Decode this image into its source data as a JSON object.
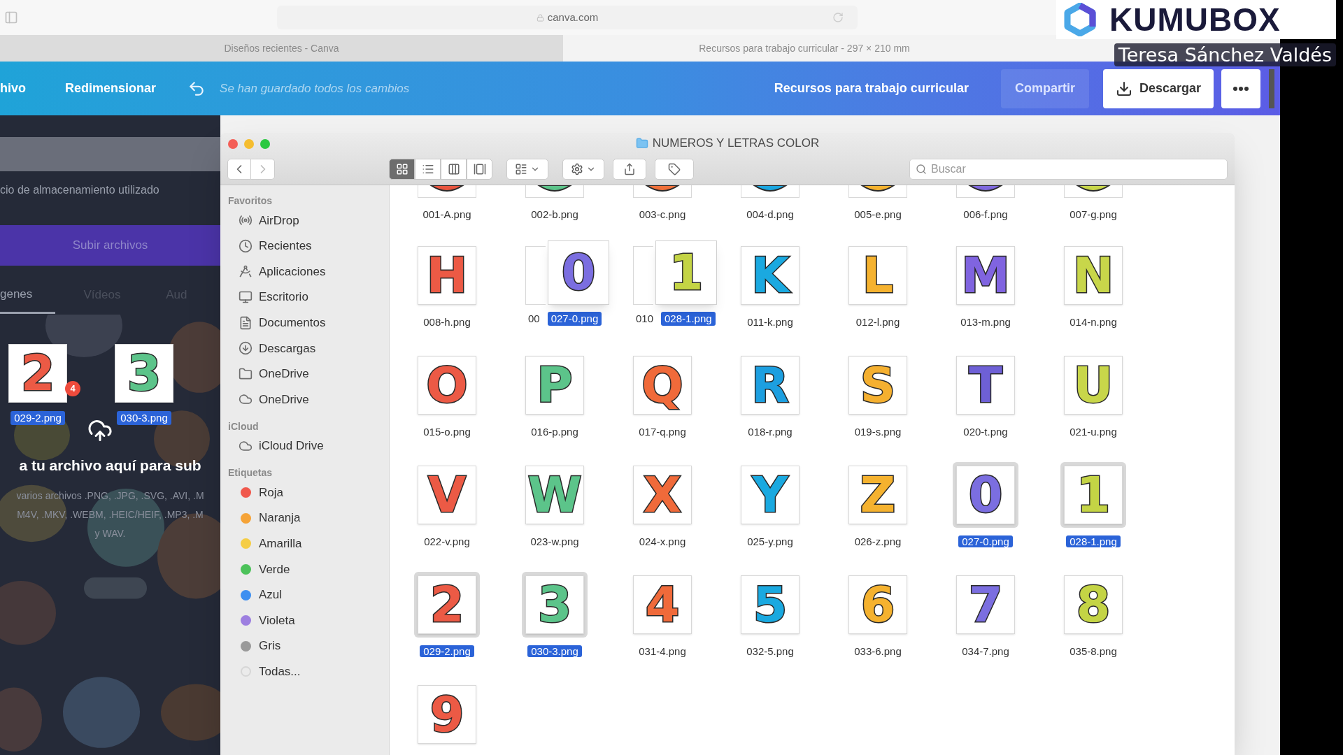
{
  "browser": {
    "url": "canva.com",
    "tabs": [
      {
        "title": "Diseños recientes - Canva",
        "selected": false
      },
      {
        "title": "Recursos para trabajo curricular - 297 × 210 mm",
        "selected": true
      }
    ]
  },
  "overlay": {
    "brand": "KUMUBOX",
    "presenter": "Teresa Sánchez Valdés"
  },
  "editor_toolbar": {
    "menu_items": [
      "hivo",
      "Redimensionar"
    ],
    "save_status": "Se han guardado todos los cambios",
    "design_title": "Recursos para trabajo curricular",
    "share": "Compartir",
    "download": "Descargar"
  },
  "uploads_panel": {
    "storage_text": "cio de almacenamiento utilizado",
    "upload_button": "Subir archivos",
    "tabs": [
      {
        "label": "genes",
        "selected": true
      },
      {
        "label": "Vídeos",
        "selected": false
      },
      {
        "label": "Aud",
        "selected": false
      }
    ],
    "drag_items": [
      {
        "glyph": "2",
        "label": "029-2.png",
        "color": "#ec5a45"
      },
      {
        "glyph": "3",
        "label": "030-3.png",
        "color": "#5cc48a"
      }
    ],
    "drag_count": "4",
    "drop_title": "a tu archivo aquí para sub",
    "drop_hint": [
      "varios archivos .PNG, .JPG, .SVG, .AVI, .M",
      "M4V, .MKV, .WEBM, .HEIC/HEIF, .MP3, .M",
      "y WAV."
    ]
  },
  "finder": {
    "title": "NUMEROS Y LETRAS COLOR",
    "search_placeholder": "Buscar",
    "view_modes": [
      {
        "kind": "icons",
        "selected": true
      },
      {
        "kind": "list",
        "selected": false
      },
      {
        "kind": "columns",
        "selected": false
      },
      {
        "kind": "gallery",
        "selected": false
      }
    ],
    "sidebar": [
      {
        "heading": "Favoritos",
        "items": [
          {
            "label": "AirDrop",
            "kind": "airdrop"
          },
          {
            "label": "Recientes",
            "kind": "recents"
          },
          {
            "label": "Aplicaciones",
            "kind": "applications"
          },
          {
            "label": "Escritorio",
            "kind": "desktop"
          },
          {
            "label": "Documentos",
            "kind": "documents"
          },
          {
            "label": "Descargas",
            "kind": "downloads"
          },
          {
            "label": "OneDrive",
            "kind": "folder"
          },
          {
            "label": "OneDrive",
            "kind": "cloud"
          }
        ]
      },
      {
        "heading": "iCloud",
        "items": [
          {
            "label": "iCloud Drive",
            "kind": "cloud"
          }
        ]
      },
      {
        "heading": "Etiquetas",
        "items": [
          {
            "label": "Roja",
            "kind": "tag",
            "color": "#f0584c"
          },
          {
            "label": "Naranja",
            "kind": "tag",
            "color": "#f5a337"
          },
          {
            "label": "Amarilla",
            "kind": "tag",
            "color": "#f5cd45"
          },
          {
            "label": "Verde",
            "kind": "tag",
            "color": "#4cc25a"
          },
          {
            "label": "Azul",
            "kind": "tag",
            "color": "#3d8ff0"
          },
          {
            "label": "Violeta",
            "kind": "tag",
            "color": "#9d7fe0"
          },
          {
            "label": "Gris",
            "kind": "tag",
            "color": "#9a9a9a"
          },
          {
            "label": "Todas...",
            "kind": "all",
            "color": "#d6d6d6"
          }
        ]
      }
    ],
    "files": [
      {
        "kind": "partial",
        "label": "001-A.png",
        "color": "#e8553f",
        "selected": false
      },
      {
        "kind": "partial",
        "label": "002-b.png",
        "color": "#5cc48a",
        "selected": false
      },
      {
        "kind": "partial",
        "label": "003-c.png",
        "color": "#f0703a",
        "selected": false
      },
      {
        "kind": "partial",
        "label": "004-d.png",
        "color": "#1aa6e0",
        "selected": false
      },
      {
        "kind": "partial",
        "label": "005-e.png",
        "color": "#f5b22f",
        "selected": false
      },
      {
        "kind": "partial",
        "label": "006-f.png",
        "color": "#7e68dd",
        "selected": false
      },
      {
        "kind": "partial",
        "label": "007-g.png",
        "color": "#c8d64a",
        "selected": false
      },
      {
        "kind": "file",
        "glyph": "H",
        "label": "008-h.png",
        "color": "#ec5a45",
        "selected": false
      },
      {
        "kind": "covered",
        "label": "00",
        "selected": false,
        "ghost": {
          "glyph": "0",
          "label": "027-0.png",
          "color": "#7b6ee0"
        }
      },
      {
        "kind": "covered",
        "label": "010",
        "selected": false,
        "ghost": {
          "glyph": "1",
          "label": "028-1.png",
          "color": "#c4d445"
        }
      },
      {
        "kind": "file",
        "glyph": "K",
        "label": "011-k.png",
        "color": "#1aa9e0",
        "selected": false
      },
      {
        "kind": "file",
        "glyph": "L",
        "label": "012-l.png",
        "color": "#f5b22f",
        "selected": false
      },
      {
        "kind": "file",
        "glyph": "M",
        "label": "013-m.png",
        "color": "#8064e0",
        "selected": false
      },
      {
        "kind": "file",
        "glyph": "N",
        "label": "014-n.png",
        "color": "#c8d64a",
        "selected": false
      },
      {
        "kind": "file",
        "glyph": "O",
        "label": "015-o.png",
        "color": "#ec5a45",
        "selected": false
      },
      {
        "kind": "file",
        "glyph": "P",
        "label": "016-p.png",
        "color": "#5cc48a",
        "selected": false
      },
      {
        "kind": "file",
        "glyph": "Q",
        "label": "017-q.png",
        "color": "#f06a3a",
        "selected": false
      },
      {
        "kind": "file",
        "glyph": "R",
        "label": "018-r.png",
        "color": "#1d9fe0",
        "selected": false
      },
      {
        "kind": "file",
        "glyph": "S",
        "label": "019-s.png",
        "color": "#f5b030",
        "selected": false
      },
      {
        "kind": "file",
        "glyph": "T",
        "label": "020-t.png",
        "color": "#6e60d6",
        "selected": false
      },
      {
        "kind": "file",
        "glyph": "U",
        "label": "021-u.png",
        "color": "#c8d64a",
        "selected": false
      },
      {
        "kind": "file",
        "glyph": "V",
        "label": "022-v.png",
        "color": "#ec5a45",
        "selected": false
      },
      {
        "kind": "file",
        "glyph": "W",
        "label": "023-w.png",
        "color": "#5cc48a",
        "selected": false
      },
      {
        "kind": "file",
        "glyph": "X",
        "label": "024-x.png",
        "color": "#f06a3a",
        "selected": false
      },
      {
        "kind": "file",
        "glyph": "Y",
        "label": "025-y.png",
        "color": "#1aa9e0",
        "selected": false
      },
      {
        "kind": "file",
        "glyph": "Z",
        "label": "026-z.png",
        "color": "#f5b22f",
        "selected": false
      },
      {
        "kind": "file",
        "glyph": "0",
        "label": "027-0.png",
        "color": "#7b6ee0",
        "selected": true
      },
      {
        "kind": "file",
        "glyph": "1",
        "label": "028-1.png",
        "color": "#c4d445",
        "selected": true
      },
      {
        "kind": "file",
        "glyph": "2",
        "label": "029-2.png",
        "color": "#ec5a45",
        "selected": true
      },
      {
        "kind": "file",
        "glyph": "3",
        "label": "030-3.png",
        "color": "#5cc48a",
        "selected": true
      },
      {
        "kind": "file",
        "glyph": "4",
        "label": "031-4.png",
        "color": "#f06a3a",
        "selected": false
      },
      {
        "kind": "file",
        "glyph": "5",
        "label": "032-5.png",
        "color": "#1aa9e0",
        "selected": false
      },
      {
        "kind": "file",
        "glyph": "6",
        "label": "033-6.png",
        "color": "#f5b22f",
        "selected": false
      },
      {
        "kind": "file",
        "glyph": "7",
        "label": "034-7.png",
        "color": "#7b6ee0",
        "selected": false
      },
      {
        "kind": "file",
        "glyph": "8",
        "label": "035-8.png",
        "color": "#c4d445",
        "selected": false
      },
      {
        "kind": "file",
        "glyph": "9",
        "color": "#ec5a45",
        "selected": false
      }
    ]
  }
}
